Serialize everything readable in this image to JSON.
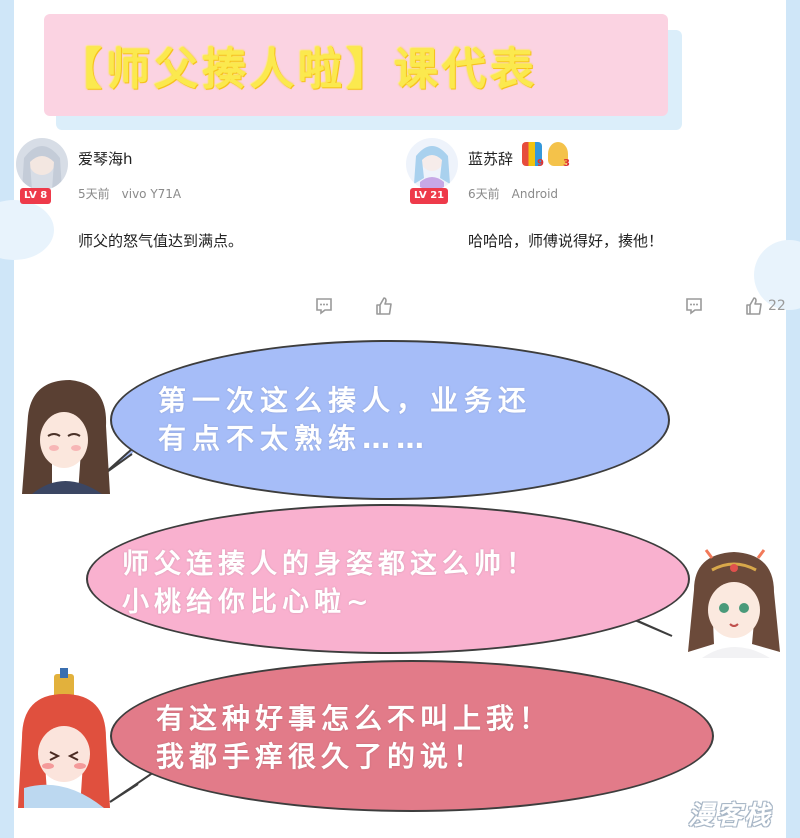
{
  "title": "【师父揍人啦】课代表",
  "colors": {
    "title_fill": "#fbe94e",
    "title_bg": "#fbd3e2",
    "bubble_blue": "#a6bdf8",
    "bubble_pink": "#f9b1cf",
    "bubble_red": "#e27b89",
    "level_badge": "#ee3a4a"
  },
  "comments": [
    {
      "username": "爱琴海h",
      "level": "LV 8",
      "time": "5天前",
      "device": "vivo Y71A",
      "text": "师父的怒气值达到满点。",
      "likes": ""
    },
    {
      "username": "蓝苏辞",
      "level": "LV 21",
      "time": "6天前",
      "device": "Android",
      "text": "哈哈哈，师傅说得好，揍他！",
      "badge_counts": [
        "9",
        "3"
      ],
      "likes": "22"
    }
  ],
  "bubbles": [
    {
      "line1": "第一次这么揍人，业务还",
      "line2": "有点不太熟练……"
    },
    {
      "line1": "师父连揍人的身姿都这么帅！",
      "line2": "小桃给你比心啦~"
    },
    {
      "line1": "有这种好事怎么不叫上我！",
      "line2": "我都手痒很久了的说！"
    }
  ],
  "icons": [
    "comment-icon",
    "like-icon"
  ],
  "watermark": "漫客栈"
}
